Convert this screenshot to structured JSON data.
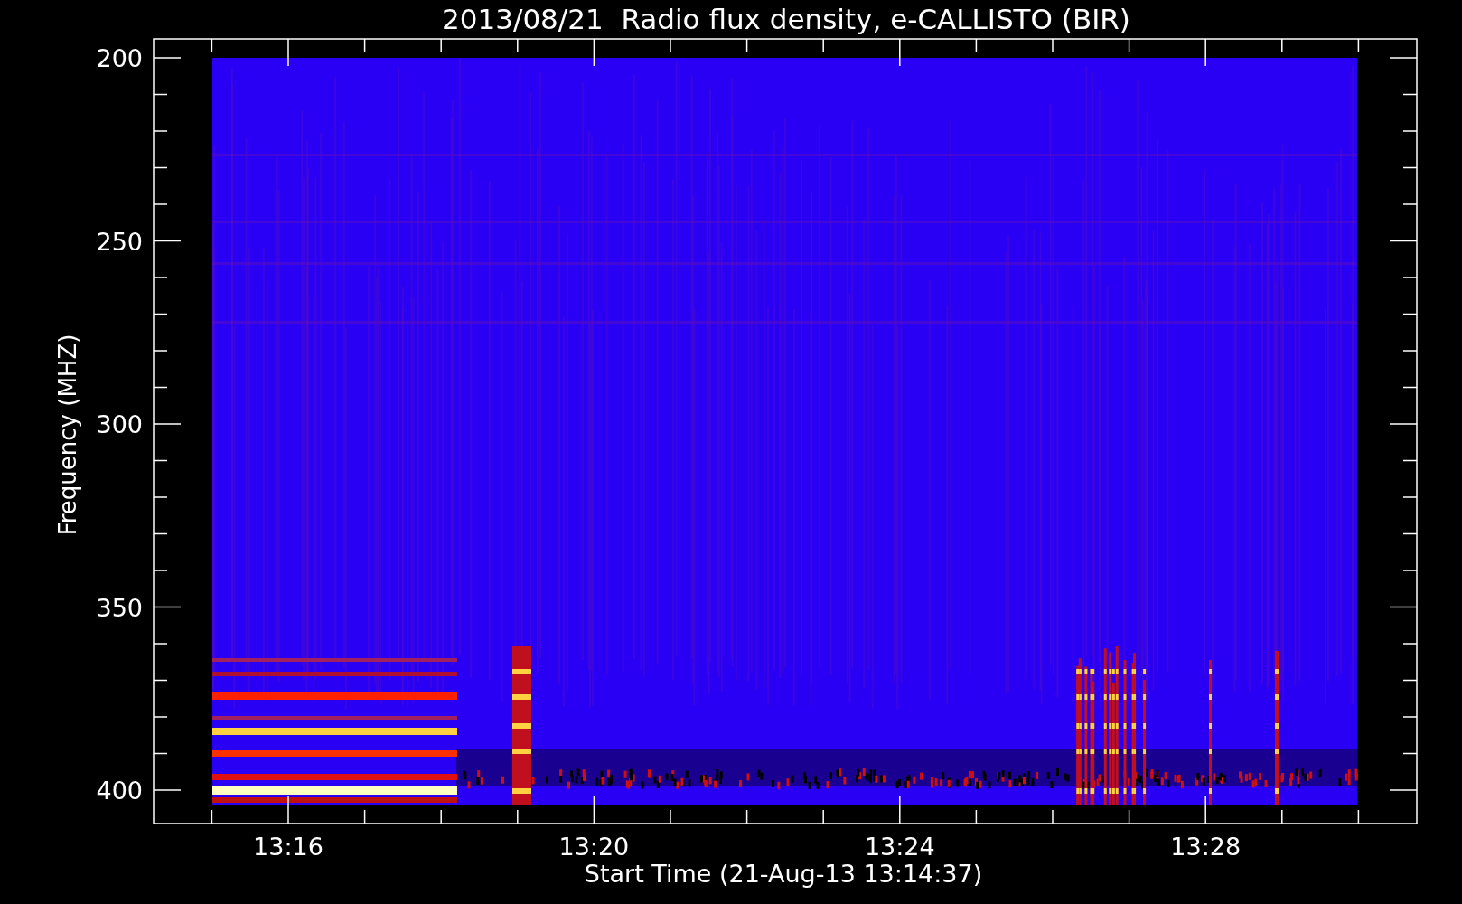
{
  "chart": {
    "title": "2013/08/21  Radio flux density, e-CALLISTO (BIR)",
    "ylabel": "Frequency (MHZ)",
    "xlabel": "Start Time (21-Aug-13 13:14:37)",
    "y_tick_labels": [
      "200",
      "250",
      "300",
      "350",
      "400"
    ],
    "x_tick_labels": [
      "13:16",
      "13:20",
      "13:24",
      "13:28"
    ]
  }
}
